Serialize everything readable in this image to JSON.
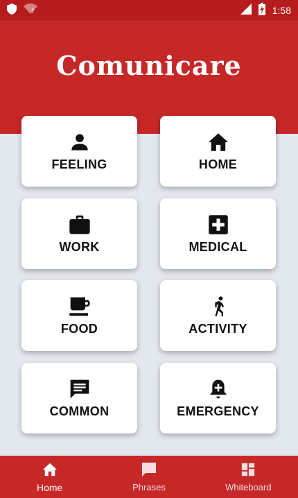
{
  "status_bar": {
    "time": "1:58",
    "icons": [
      "shield-icon",
      "wifi-question-icon",
      "signal-icon",
      "battery-charging-icon"
    ]
  },
  "app": {
    "title": "Comunicare"
  },
  "categories": [
    {
      "label": "FEELING",
      "icon": "person-icon"
    },
    {
      "label": "HOME",
      "icon": "house-icon"
    },
    {
      "label": "WORK",
      "icon": "briefcase-icon"
    },
    {
      "label": "MEDICAL",
      "icon": "medical-cross-icon"
    },
    {
      "label": "FOOD",
      "icon": "coffee-cup-icon"
    },
    {
      "label": "ACTIVITY",
      "icon": "running-person-icon"
    },
    {
      "label": "COMMON",
      "icon": "chat-message-icon"
    },
    {
      "label": "EMERGENCY",
      "icon": "alarm-bell-icon"
    }
  ],
  "bottom_nav": {
    "items": [
      {
        "label": "Home",
        "icon": "home-icon",
        "active": true
      },
      {
        "label": "Phrases",
        "icon": "message-icon",
        "active": false
      },
      {
        "label": "Whiteboard",
        "icon": "dashboard-icon",
        "active": false
      }
    ]
  },
  "colors": {
    "primary": "#c62828",
    "primary_dark": "#b71c1c",
    "background": "#e3e8ef",
    "card": "#ffffff"
  }
}
